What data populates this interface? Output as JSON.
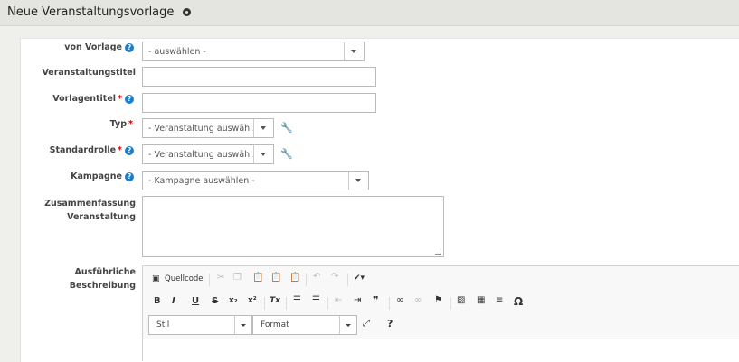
{
  "header": {
    "title": "Neue Veranstaltungsvorlage",
    "settings_icon": "gear-icon"
  },
  "form": {
    "von_vorlage": {
      "label": "von Vorlage",
      "value": "- auswählen -"
    },
    "veranstaltungstitel": {
      "label": "Veranstaltungstitel",
      "value": ""
    },
    "vorlagentitel": {
      "label": "Vorlagentitel",
      "required": "*",
      "value": ""
    },
    "typ": {
      "label": "Typ",
      "required": "*",
      "value": "- Veranstaltung auswähl..."
    },
    "standardrolle": {
      "label": "Standardrolle",
      "required": "*",
      "value": "- Veranstaltung auswähl..."
    },
    "kampagne": {
      "label": "Kampagne",
      "value": "- Kampagne auswählen -"
    },
    "zusammenfassung": {
      "label_line1": "Zusammenfassung",
      "label_line2": "Veranstaltung",
      "value": ""
    },
    "beschreibung": {
      "label_line1": "Ausführliche",
      "label_line2": "Beschreibung"
    }
  },
  "help_glyph": "?",
  "editor": {
    "source_label": "Quellcode",
    "style_value": "Stil",
    "format_value": "Format",
    "bold": "B",
    "italic": "I",
    "underline": "U",
    "strike": "S",
    "subscript": "x₂",
    "superscript": "x²",
    "remove_format": "Tx",
    "blockquote": "❞",
    "special_char": "Ω",
    "help": "?"
  },
  "colors": {
    "accent": "#1a7ecb",
    "required": "#cc0000",
    "header_bg": "#e4e4e0"
  }
}
